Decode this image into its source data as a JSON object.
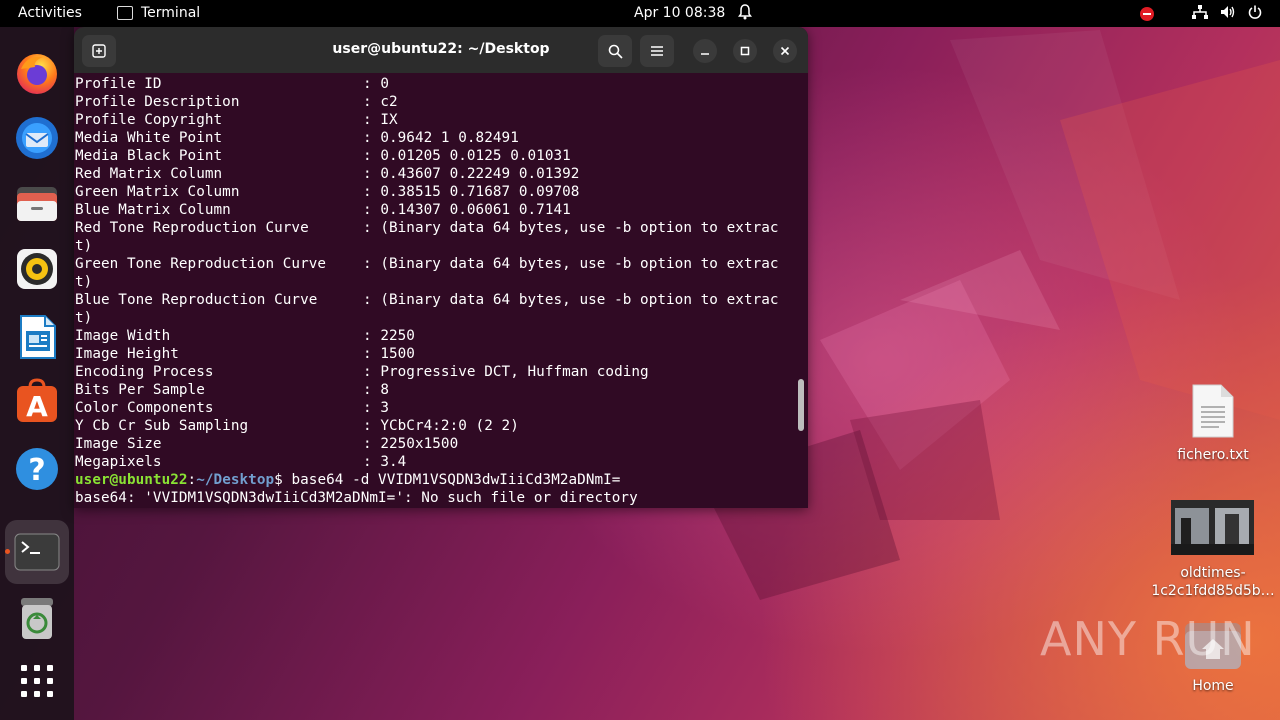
{
  "topbar": {
    "activities": "Activities",
    "app_name": "Terminal",
    "clock": "Apr 10  08:38"
  },
  "dock": {
    "items": [
      {
        "name": "firefox",
        "icon": "firefox-icon"
      },
      {
        "name": "thunderbird",
        "icon": "thunderbird-icon"
      },
      {
        "name": "files",
        "icon": "files-icon"
      },
      {
        "name": "rhythmbox",
        "icon": "rhythmbox-icon"
      },
      {
        "name": "writer",
        "icon": "libreoffice-writer-icon"
      },
      {
        "name": "app-center",
        "icon": "app-center-icon"
      },
      {
        "name": "help",
        "icon": "help-icon"
      },
      {
        "name": "terminal",
        "icon": "terminal-icon"
      },
      {
        "name": "trash",
        "icon": "trash-icon"
      },
      {
        "name": "show-apps",
        "icon": "grid-icon"
      }
    ]
  },
  "terminal": {
    "title": "user@ubuntu22: ~/Desktop",
    "rows": [
      {
        "key": "Profile ID",
        "value": "0"
      },
      {
        "key": "Profile Description",
        "value": "c2"
      },
      {
        "key": "Profile Copyright",
        "value": "IX"
      },
      {
        "key": "Media White Point",
        "value": "0.9642 1 0.82491"
      },
      {
        "key": "Media Black Point",
        "value": "0.01205 0.0125 0.01031"
      },
      {
        "key": "Red Matrix Column",
        "value": "0.43607 0.22249 0.01392"
      },
      {
        "key": "Green Matrix Column",
        "value": "0.38515 0.71687 0.09708"
      },
      {
        "key": "Blue Matrix Column",
        "value": "0.14307 0.06061 0.7141"
      },
      {
        "key": "Red Tone Reproduction Curve",
        "value": "(Binary data 64 bytes, use -b option to extrac",
        "wrap": "t)"
      },
      {
        "key": "Green Tone Reproduction Curve",
        "value": "(Binary data 64 bytes, use -b option to extrac",
        "wrap": "t)"
      },
      {
        "key": "Blue Tone Reproduction Curve",
        "value": "(Binary data 64 bytes, use -b option to extrac",
        "wrap": "t)"
      },
      {
        "key": "Image Width",
        "value": "2250"
      },
      {
        "key": "Image Height",
        "value": "1500"
      },
      {
        "key": "Encoding Process",
        "value": "Progressive DCT, Huffman coding"
      },
      {
        "key": "Bits Per Sample",
        "value": "8"
      },
      {
        "key": "Color Components",
        "value": "3"
      },
      {
        "key": "Y Cb Cr Sub Sampling",
        "value": "YCbCr4:2:0 (2 2)"
      },
      {
        "key": "Image Size",
        "value": "2250x1500"
      },
      {
        "key": "Megapixels",
        "value": "3.4"
      }
    ],
    "separator": ": ",
    "prompt_user": "user@ubuntu22",
    "prompt_sep": ":",
    "prompt_path": "~/Desktop",
    "prompt_dollar": "$ ",
    "command": "base64 -d VVIDM1VSQDN3dwIiiCd3M2aDNmI=",
    "output": "base64: 'VVIDM1VSQDN3dwIiiCd3M2aDNmI=': No such file or directory"
  },
  "desktop": {
    "icons": [
      {
        "label": "fichero.txt",
        "icon": "text-file-icon"
      },
      {
        "label_line1": "oldtimes-",
        "label_line2": "1c2c1fdd85d5b…",
        "icon": "video-thumbnail-icon"
      },
      {
        "label": "Home",
        "icon": "home-folder-icon"
      }
    ]
  },
  "watermark": "ANY RUN",
  "colors": {
    "terminal_bg": "#300a24",
    "prompt_user": "#8ae234",
    "prompt_path": "#729fcf",
    "ubuntu_orange": "#e95420"
  }
}
